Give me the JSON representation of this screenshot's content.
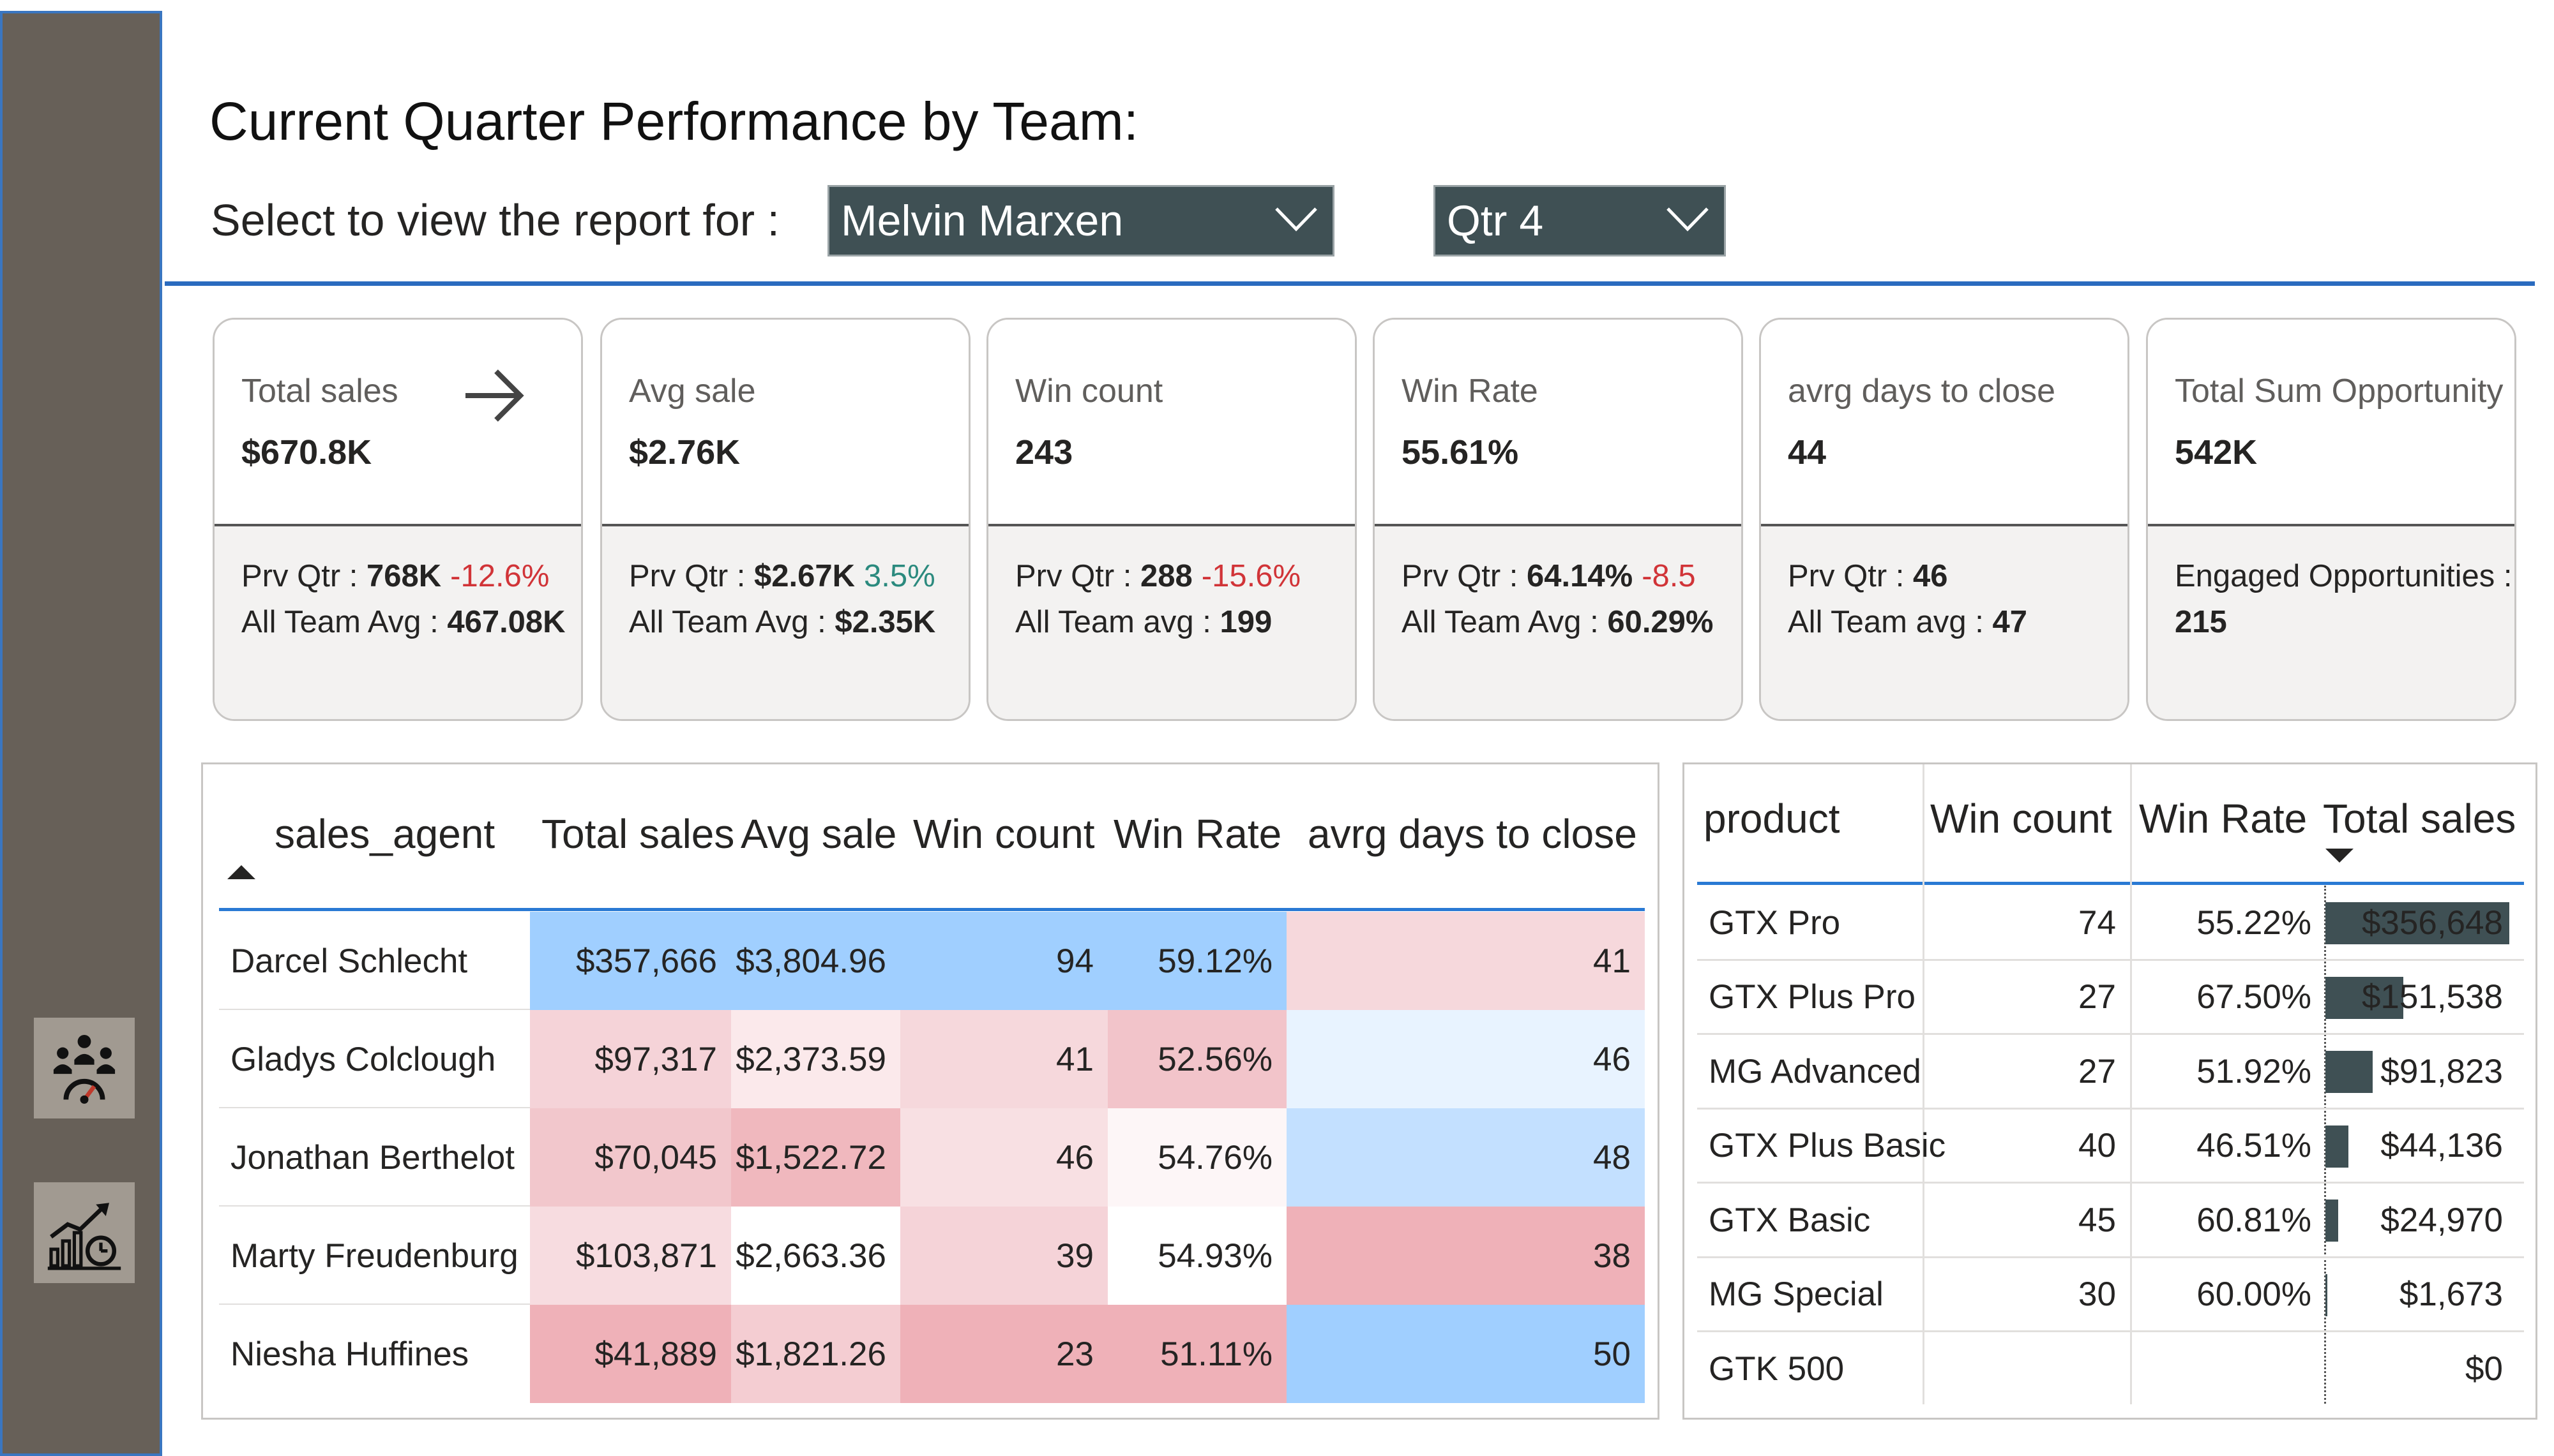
{
  "header": {
    "title": "Current Quarter Performance by Team:",
    "select_label": "Select  to view the report for :",
    "agent_selected": "Melvin Marxen",
    "quarter_selected": "Qtr 4"
  },
  "sidebar": {
    "items": [
      {
        "icon": "team-dashboard-icon"
      },
      {
        "icon": "sales-growth-chart-icon"
      }
    ]
  },
  "colors": {
    "sidebar_bg": "#676058",
    "dropdown_bg": "#3f5054",
    "accent_blue": "#2a6bbf",
    "negative": "#d13438",
    "positive": "#2b8a7e",
    "bar": "#3f5054"
  },
  "cards": [
    {
      "label": "Total sales",
      "value": "$670.8K",
      "line1_label": "Prv Qtr : ",
      "line1_value": "768K",
      "line1_delta": "-12.6%",
      "line1_delta_sign": "neg",
      "line2_label": "All Team Avg : ",
      "line2_value": "467.08K"
    },
    {
      "label": "Avg sale",
      "value": "$2.76K",
      "line1_label": "Prv Qtr : ",
      "line1_value": "$2.67K",
      "line1_delta": "3.5%",
      "line1_delta_sign": "pos",
      "line2_label": "All Team Avg : ",
      "line2_value": "$2.35K"
    },
    {
      "label": "Win count",
      "value": "243",
      "line1_label": "Prv Qtr : ",
      "line1_value": "288",
      "line1_delta": "-15.6%",
      "line1_delta_sign": "neg",
      "line2_label": "All Team avg : ",
      "line2_value": "199"
    },
    {
      "label": "Win Rate",
      "value": "55.61%",
      "line1_label": "Prv Qtr : ",
      "line1_value": "64.14%",
      "line1_delta": "-8.5",
      "line1_delta_sign": "neg",
      "line2_label": "All Team Avg : ",
      "line2_value": "60.29%"
    },
    {
      "label": "avrg days to close",
      "value": "44",
      "line1_label": "Prv Qtr : ",
      "line1_value": "46",
      "line1_delta": "",
      "line1_delta_sign": "",
      "line2_label": "All Team avg : ",
      "line2_value": "47"
    },
    {
      "label": "Total Sum Opportunity",
      "value": "542K",
      "line1_label": "Engaged Opportunities :",
      "line1_value": "",
      "line1_delta": "",
      "line1_delta_sign": "",
      "line2_label": "",
      "line2_value": "215"
    }
  ],
  "agent_table": {
    "columns": [
      "sales_agent",
      "Total sales",
      "Avg sale",
      "Win count",
      "Win Rate",
      "avrg days to close"
    ],
    "rows": [
      {
        "cells": [
          "Darcel Schlecht",
          "$357,666",
          "$3,804.96",
          "94",
          "59.12%",
          "41"
        ],
        "colors": [
          "#ffffff",
          "#a0cfff",
          "#a0cfff",
          "#a0cfff",
          "#a0cfff",
          "#f6d8dc"
        ]
      },
      {
        "cells": [
          "Gladys Colclough",
          "$97,317",
          "$2,373.59",
          "41",
          "52.56%",
          "46"
        ],
        "colors": [
          "#ffffff",
          "#f5d3d8",
          "#fbe9eb",
          "#f6d8dc",
          "#f2c4ca",
          "#e8f3ff"
        ]
      },
      {
        "cells": [
          "Jonathan Berthelot",
          "$70,045",
          "$1,522.72",
          "46",
          "54.76%",
          "48"
        ],
        "colors": [
          "#ffffff",
          "#f2c7cc",
          "#f0b8be",
          "#f8e0e3",
          "#fdf6f7",
          "#c3e0ff"
        ]
      },
      {
        "cells": [
          "Marty Freudenburg",
          "$103,871",
          "$2,663.36",
          "39",
          "54.93%",
          "38"
        ],
        "colors": [
          "#ffffff",
          "#f7dce0",
          "#ffffff",
          "#f5d3d8",
          "#ffffff",
          "#efb1b8"
        ]
      },
      {
        "cells": [
          "Niesha Huffines",
          "$41,889",
          "$1,821.26",
          "23",
          "51.11%",
          "50"
        ],
        "colors": [
          "#ffffff",
          "#efb1b8",
          "#f4cdd2",
          "#efb1b8",
          "#efb1b8",
          "#a0cfff"
        ]
      }
    ]
  },
  "product_table": {
    "columns": [
      "product",
      "Win count",
      "Win Rate",
      "Total sales"
    ],
    "rows": [
      {
        "cells": [
          "GTX Pro",
          "74",
          "55.22%",
          "$356,648"
        ],
        "sales": 356648
      },
      {
        "cells": [
          "GTX Plus Pro",
          "27",
          "67.50%",
          "$151,538"
        ],
        "sales": 151538
      },
      {
        "cells": [
          "MG Advanced",
          "27",
          "51.92%",
          "$91,823"
        ],
        "sales": 91823
      },
      {
        "cells": [
          "GTX Plus Basic",
          "40",
          "46.51%",
          "$44,136"
        ],
        "sales": 44136
      },
      {
        "cells": [
          "GTX Basic",
          "45",
          "60.81%",
          "$24,970"
        ],
        "sales": 24970
      },
      {
        "cells": [
          "MG Special",
          "30",
          "60.00%",
          "$1,673"
        ],
        "sales": 1673
      },
      {
        "cells": [
          "GTK 500",
          "",
          "",
          "$0"
        ],
        "sales": 0
      }
    ]
  }
}
